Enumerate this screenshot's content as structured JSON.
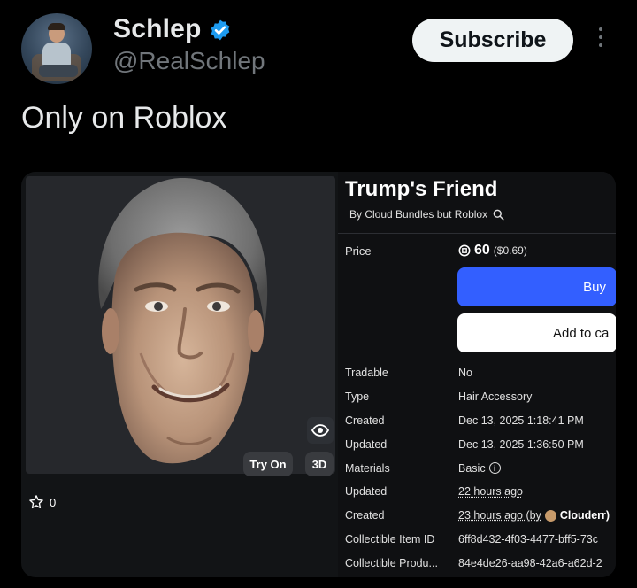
{
  "tweet": {
    "display_name": "Schlep",
    "handle": "@RealSchlep",
    "subscribe_label": "Subscribe",
    "text": "Only on Roblox"
  },
  "item": {
    "title": "Trump's Friend",
    "creator": "By Cloud Bundles but Roblox",
    "try_on_label": "Try On",
    "view_3d_label": "3D",
    "favorites": "0",
    "price_label": "Price",
    "price_robux": "60",
    "price_usd": "($0.69)",
    "buy_label": "Buy",
    "add_to_cart_label": "Add to ca",
    "details": [
      {
        "key": "Tradable",
        "value": "No"
      },
      {
        "key": "Type",
        "value": "Hair Accessory"
      },
      {
        "key": "Created",
        "value": "Dec 13, 2025 1:18:41 PM"
      },
      {
        "key": "Updated",
        "value": "Dec 13, 2025 1:36:50 PM"
      },
      {
        "key": "Materials",
        "value": "Basic"
      },
      {
        "key": "Updated",
        "value": "22 hours ago"
      },
      {
        "key": "Created",
        "value": "23 hours ago (by",
        "by_user": "Clouderr)"
      },
      {
        "key": "Collectible Item ID",
        "value": "6ff8d432-4f03-4477-bff5-73c"
      },
      {
        "key": "Collectible Produ...",
        "value": "84e4de26-aa98-42a6-a62d-2"
      }
    ]
  },
  "colors": {
    "background": "#000000",
    "verified_badge": "#1d9bf0",
    "buy_button": "#335fff",
    "subscribe_bg": "#eff3f4"
  },
  "icons": [
    "verified-badge-icon",
    "more-icon",
    "search-icon",
    "eye-icon",
    "star-icon",
    "robux-icon",
    "info-icon"
  ]
}
